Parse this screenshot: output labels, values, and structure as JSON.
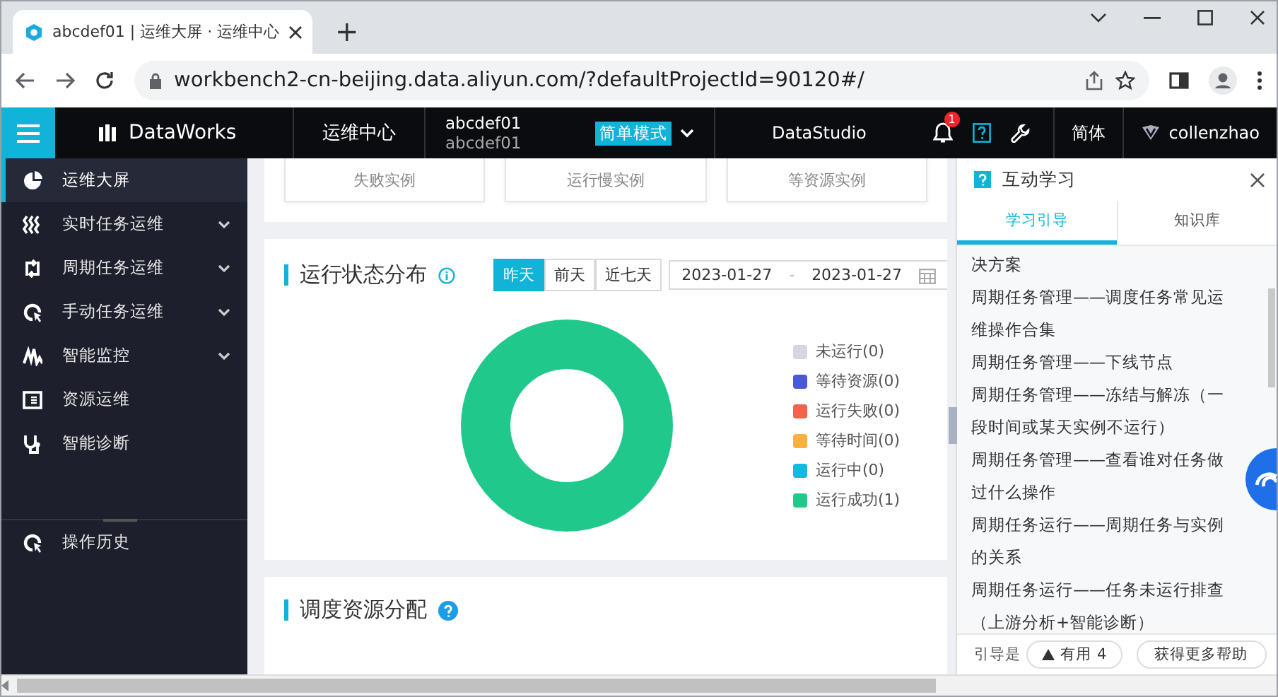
{
  "browser": {
    "tab_title": "abcdef01 | 运维大屏 · 运维中心",
    "new_tab": "+",
    "url": "workbench2-cn-beijing.data.aliyun.com/?defaultProjectId=90120#/"
  },
  "header": {
    "logo": "DataWorks",
    "module": "运维中心",
    "project": "abcdef01",
    "project_sub": "abcdef01",
    "mode": "简单模式",
    "studio": "DataStudio",
    "notifications": "1",
    "language": "简体",
    "user": "collenzhao"
  },
  "sidebar": {
    "items": [
      {
        "label": "运维大屏",
        "selected": true,
        "expandable": false
      },
      {
        "label": "实时任务运维",
        "selected": false,
        "expandable": true
      },
      {
        "label": "周期任务运维",
        "selected": false,
        "expandable": true
      },
      {
        "label": "手动任务运维",
        "selected": false,
        "expandable": true
      },
      {
        "label": "智能监控",
        "selected": false,
        "expandable": true
      },
      {
        "label": "资源运维",
        "selected": false,
        "expandable": false
      },
      {
        "label": "智能诊断",
        "selected": false,
        "expandable": false
      }
    ],
    "bottom": {
      "label": "操作历史"
    }
  },
  "cards": [
    "失败实例",
    "运行慢实例",
    "等资源实例"
  ],
  "status_section": {
    "title": "运行状态分布",
    "ranges": [
      {
        "label": "昨天",
        "selected": true
      },
      {
        "label": "前天",
        "selected": false
      },
      {
        "label": "近七天",
        "selected": false
      }
    ],
    "date_start": "2023-01-27",
    "date_separator": "-",
    "date_end": "2023-01-27",
    "legend": [
      {
        "color": "#d3d7de"
      },
      {
        "color": "#4a5ad6"
      },
      {
        "color": "#f5624a"
      },
      {
        "color": "#fbb040"
      },
      {
        "color": "#14b9e0"
      },
      {
        "color": "#20c98b"
      }
    ],
    "chart_data": {
      "type": "pie",
      "categories": [
        "未运行(0)",
        "等待资源(0)",
        "运行失败(0)",
        "等待时间(0)",
        "运行中(0)",
        "运行成功(1)"
      ],
      "values": [
        0,
        0,
        0,
        0,
        0,
        1
      ]
    }
  },
  "resource_section": {
    "title": "调度资源分配"
  },
  "help": {
    "title": "互动学习",
    "tabs": [
      {
        "label": "学习引导",
        "selected": true
      },
      {
        "label": "知识库",
        "selected": false
      }
    ],
    "items": [
      "决方案",
      "周期任务管理——调度任务常见运维操作合集",
      "周期任务管理——下线节点",
      "周期任务管理——冻结与解冻（一段时间或某天实例不运行）",
      "周期任务管理——查看谁对任务做过什么操作",
      "周期任务运行——周期任务与实例的关系",
      "周期任务运行——任务未运行排查（上游分析+智能诊断）"
    ],
    "footer_label": "引导是",
    "useful_label": "有用",
    "useful_count": "4",
    "more_help": "获得更多帮助"
  }
}
